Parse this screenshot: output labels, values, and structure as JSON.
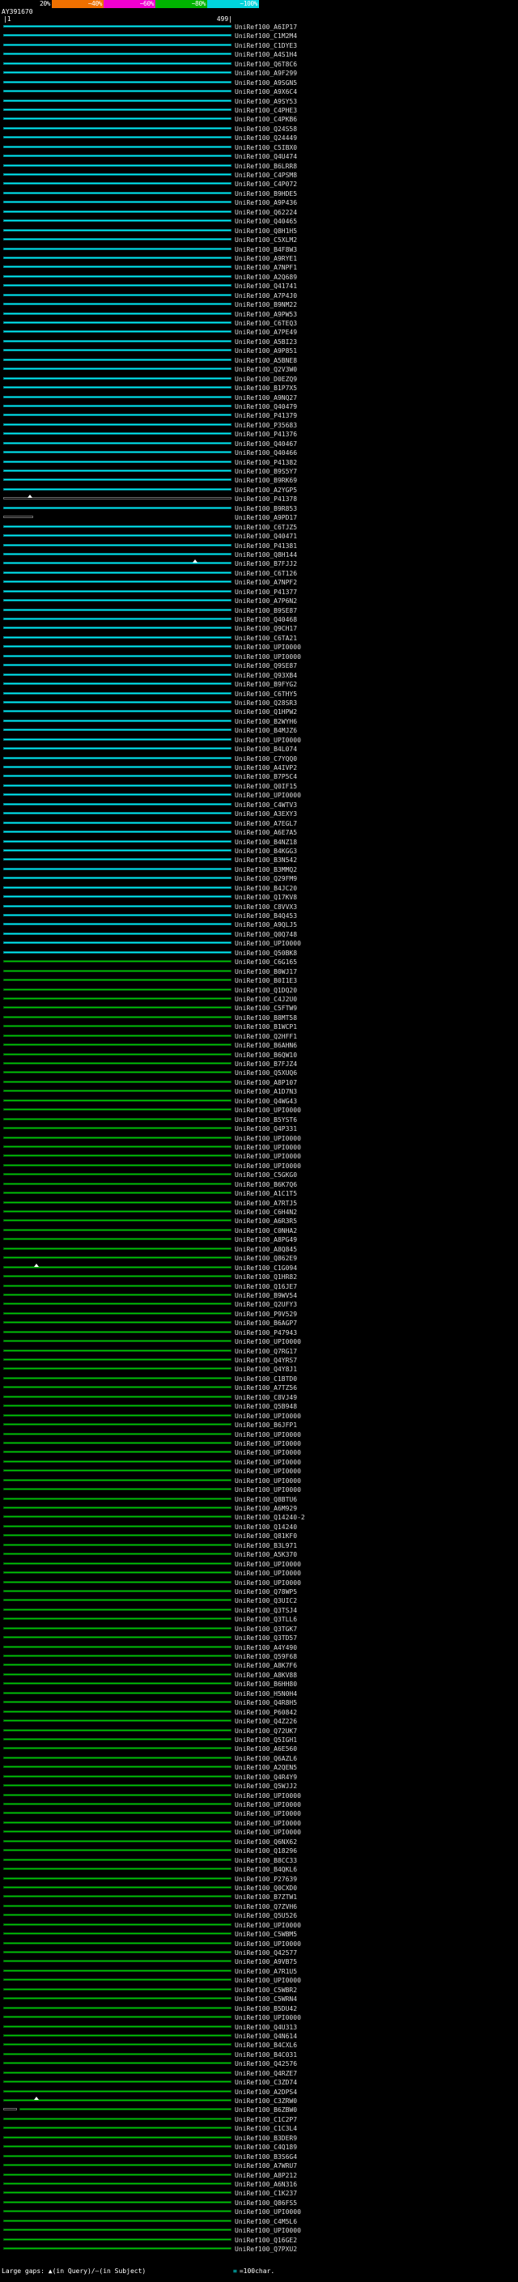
{
  "ruler": {
    "left": "|1",
    "right": "499|"
  },
  "legend": {
    "large_gaps": "Large gaps: ▲(in Query)/—(in Subject)",
    "scale_symbol": "≡",
    "scale_text": "=100char."
  },
  "chart_data": {
    "type": "bar",
    "orientation": "horizontal-tracks",
    "query": {
      "name": "AY391670",
      "start": 1,
      "end": 499
    },
    "x_range": [
      1,
      499
    ],
    "identity_key": {
      "labels": [
        "20%",
        "~40%",
        "~60%",
        "~80%",
        "~100%"
      ],
      "colors": [
        "#000000",
        "#f07000",
        "#f000d0",
        "#00b400",
        "#00d4dc"
      ]
    },
    "bucket_colors": {
      "cyan": {
        "fill": "#00e8f0",
        "border": "#007f88"
      },
      "green": {
        "fill": "#00c400",
        "border": "#005a0a"
      },
      "black": {
        "fill": "#000000",
        "border": "#6a6a6a"
      }
    },
    "label_prefix": "UniRef100_",
    "green_from_index": 101,
    "hits": [
      "A6IP17",
      "C1M2M4",
      "C1DYE3",
      "A4S1H4",
      "Q6T8C6",
      "A9F299",
      "A9SGN5",
      "A9X6C4",
      "A9SY53",
      "C4PHE3",
      "C4PKB6",
      "Q24S58",
      "Q24449",
      "C5IBX0",
      "Q4U474",
      "B6LRR8",
      "C4PSM8",
      "C4P072",
      "B9HDE5",
      "A9P436",
      "Q62224",
      "Q40465",
      "Q8H1H5",
      "C5XLM2",
      "B4F8W3",
      "A9RYE1",
      "A7NPF1",
      "A2Q689",
      "Q41741",
      "A7P4J0",
      "B9NM22",
      "A9PW53",
      "C6TEQ3",
      "A7PE49",
      "A5BI23",
      "A9P851",
      "A5BNE8",
      "Q2V3W0",
      "D0EZQ9",
      "B1P7X5",
      "A9NQ27",
      "Q40479",
      "P41379",
      "P35683",
      "P41376",
      "Q40467",
      "Q40466",
      "P41382",
      "B9S5Y7",
      "B9RK69",
      "A2YGP5",
      "P41378",
      "B9R853",
      "A9PD17",
      "C6TJZ5",
      "Q40471",
      "P41381",
      "Q8H144",
      "B7FJJ2",
      "C6T126",
      "A7NPF2",
      "P41377",
      "A7P6N2",
      "B9SE87",
      "Q40468",
      "Q9CH17",
      "C6TA21",
      "UPI0000",
      "UPI0000",
      "Q9SE87",
      "Q93XB4",
      "B9FYG2",
      "C6THY5",
      "Q28SR3",
      "Q1HPW2",
      "B2WYH6",
      "B4MJZ6",
      "UPI0000",
      "B4L074",
      "C7YQQ0",
      "A4IVP2",
      "B7P5C4",
      "Q0IF15",
      "UPI0000",
      "C4WTV3",
      "A3EXY3",
      "A7EGL7",
      "A6E7A5",
      "B4NZ18",
      "B4KGG3",
      "B3N542",
      "B3MMQ2",
      "Q29FM9",
      "B4JC20",
      "Q17KV8",
      "C8VVX3",
      "B4Q453",
      "A9QLJ5",
      "Q0Q748",
      "UPI0000",
      "Q50BK8",
      "C6G165",
      "B0WJ17",
      "B0I1E3",
      "Q1DQ20",
      "C4J2U0",
      "C5FTW9",
      "B8MT58",
      "B1WCP1",
      "Q2HFF1",
      "B6AHN6",
      "B6QW10",
      "B7FJZ4",
      "Q5XUQ6",
      "A8P107",
      "A1D7N3",
      "Q4WG43",
      "UPI0000",
      "B5YST6",
      "Q4P331",
      "UPI0000",
      "UPI0000",
      "UPI0000",
      "UPI0000",
      "C5GKG0",
      "B6K7Q6",
      "A1C1T5",
      "A7RTJ5",
      "C6H4N2",
      "A6R3R5",
      "C0NHA2",
      "A8PG49",
      "A8Q845",
      "Q862E9",
      "C1G094",
      "Q1HR82",
      "Q16JE7",
      "B9WV54",
      "Q2UFY3",
      "P9V529",
      "B6AGP7",
      "P47943",
      "UPI0000",
      "Q7RG17",
      "Q4YRS7",
      "Q4Y8J1",
      "C1BTD0",
      "A7TZ56",
      "C8VJ49",
      "Q5B948",
      "UPI0000",
      "B6JFP1",
      "UPI0000",
      "UPI0000",
      "UPI0000",
      "UPI0000",
      "UPI0000",
      "UPI0000",
      "UPI0000",
      "Q8BTU6",
      "A6M929",
      "Q14240-2",
      "Q14240",
      "Q81KF0",
      "B3L971",
      "A5K370",
      "UPI0000",
      "UPI0000",
      "UPI0000",
      "Q78WP5",
      "Q3UIC2",
      "Q3TSJ4",
      "Q3TLL6",
      "Q3TGK7",
      "Q3TD57",
      "A4Y490",
      "Q59F68",
      "A8K7F6",
      "A8KV88",
      "B6HH80",
      "H5N0H4",
      "Q4R8H5",
      "P60842",
      "Q4Z226",
      "Q72UK7",
      "Q5IGH1",
      "A6E560",
      "Q6AZL6",
      "A2QEN5",
      "Q4R4Y9",
      "Q5WJJ2",
      "UPI0000",
      "UPI0000",
      "UPI0000",
      "UPI0000",
      "UPI0000",
      "Q6NX62",
      "Q18296",
      "B8CC33",
      "B4QKL6",
      "P27639",
      "Q0CXD0",
      "B7ZTW1",
      "Q7ZVH6",
      "Q5U526",
      "UPI0000",
      "C5WBM5",
      "UPI0000",
      "Q42577",
      "A9VB75",
      "A7R1U5",
      "UPI0000",
      "C5WBR2",
      "C5WRN4",
      "B5DU42",
      "UPI0000",
      "Q4U313",
      "Q4N614",
      "B4CXL6",
      "B4C031",
      "Q42576",
      "Q4RZE7",
      "C3ZD74",
      "A2DPS4",
      "C3ZRW0",
      "B6ZBW0",
      "C1C2P7",
      "C1C3L4",
      "B3DER9",
      "C4Q189",
      "B3S6G4",
      "A7WRU7",
      "A8P212",
      "A6N316",
      "C1K237",
      "Q86FS5",
      "UPI0000",
      "C4M5L6",
      "UPI0000",
      "Q16GE2",
      "Q7PXU2"
    ],
    "overrides": {
      "51": {
        "color": "black",
        "marker_at": 60
      },
      "53": {
        "color": "black",
        "end": 66
      },
      "58": {
        "marker_at": 420
      },
      "134": {
        "marker_at": 73
      },
      "224": {
        "marker_at": 73
      },
      "225": {
        "segs": [
          {
            "start": 1,
            "end": 30,
            "color": "black"
          },
          {
            "start": 36,
            "end": 499,
            "color": "green"
          }
        ]
      }
    }
  }
}
